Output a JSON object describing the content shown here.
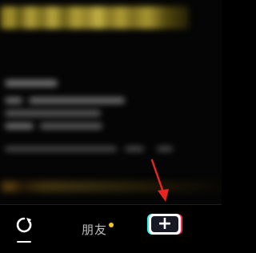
{
  "nav": {
    "home_icon": "home-refresh-icon",
    "friends_label": "朋友",
    "friends_badge_color": "#f3c623",
    "create_icon": "plus-icon",
    "create_glyph": "+"
  },
  "colors": {
    "background": "#000000",
    "accent_cyan": "#25f4ee",
    "accent_red": "#fe2c55",
    "annotation_arrow": "#e8251f"
  }
}
